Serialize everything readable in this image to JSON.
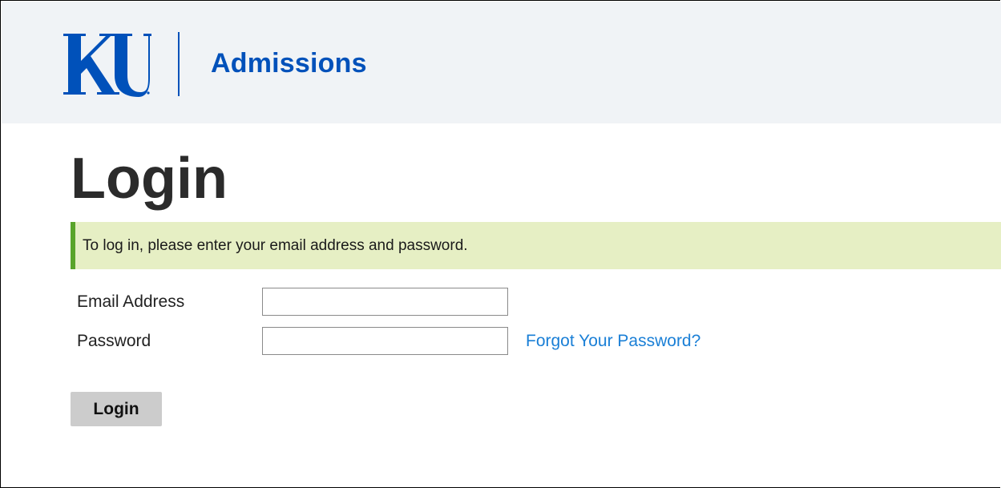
{
  "header": {
    "logo_alt": "KU",
    "site_name": "Admissions",
    "brand_color": "#0051ba",
    "background_color": "#f0f3f6"
  },
  "page": {
    "title": "Login"
  },
  "info_banner": {
    "message": "To log in, please enter your email address and password.",
    "background_color": "#e6efc4",
    "accent_color": "#59a42a"
  },
  "form": {
    "email": {
      "label": "Email Address",
      "value": ""
    },
    "password": {
      "label": "Password",
      "value": ""
    },
    "forgot_password_link": "Forgot Your Password?",
    "submit_label": "Login"
  }
}
